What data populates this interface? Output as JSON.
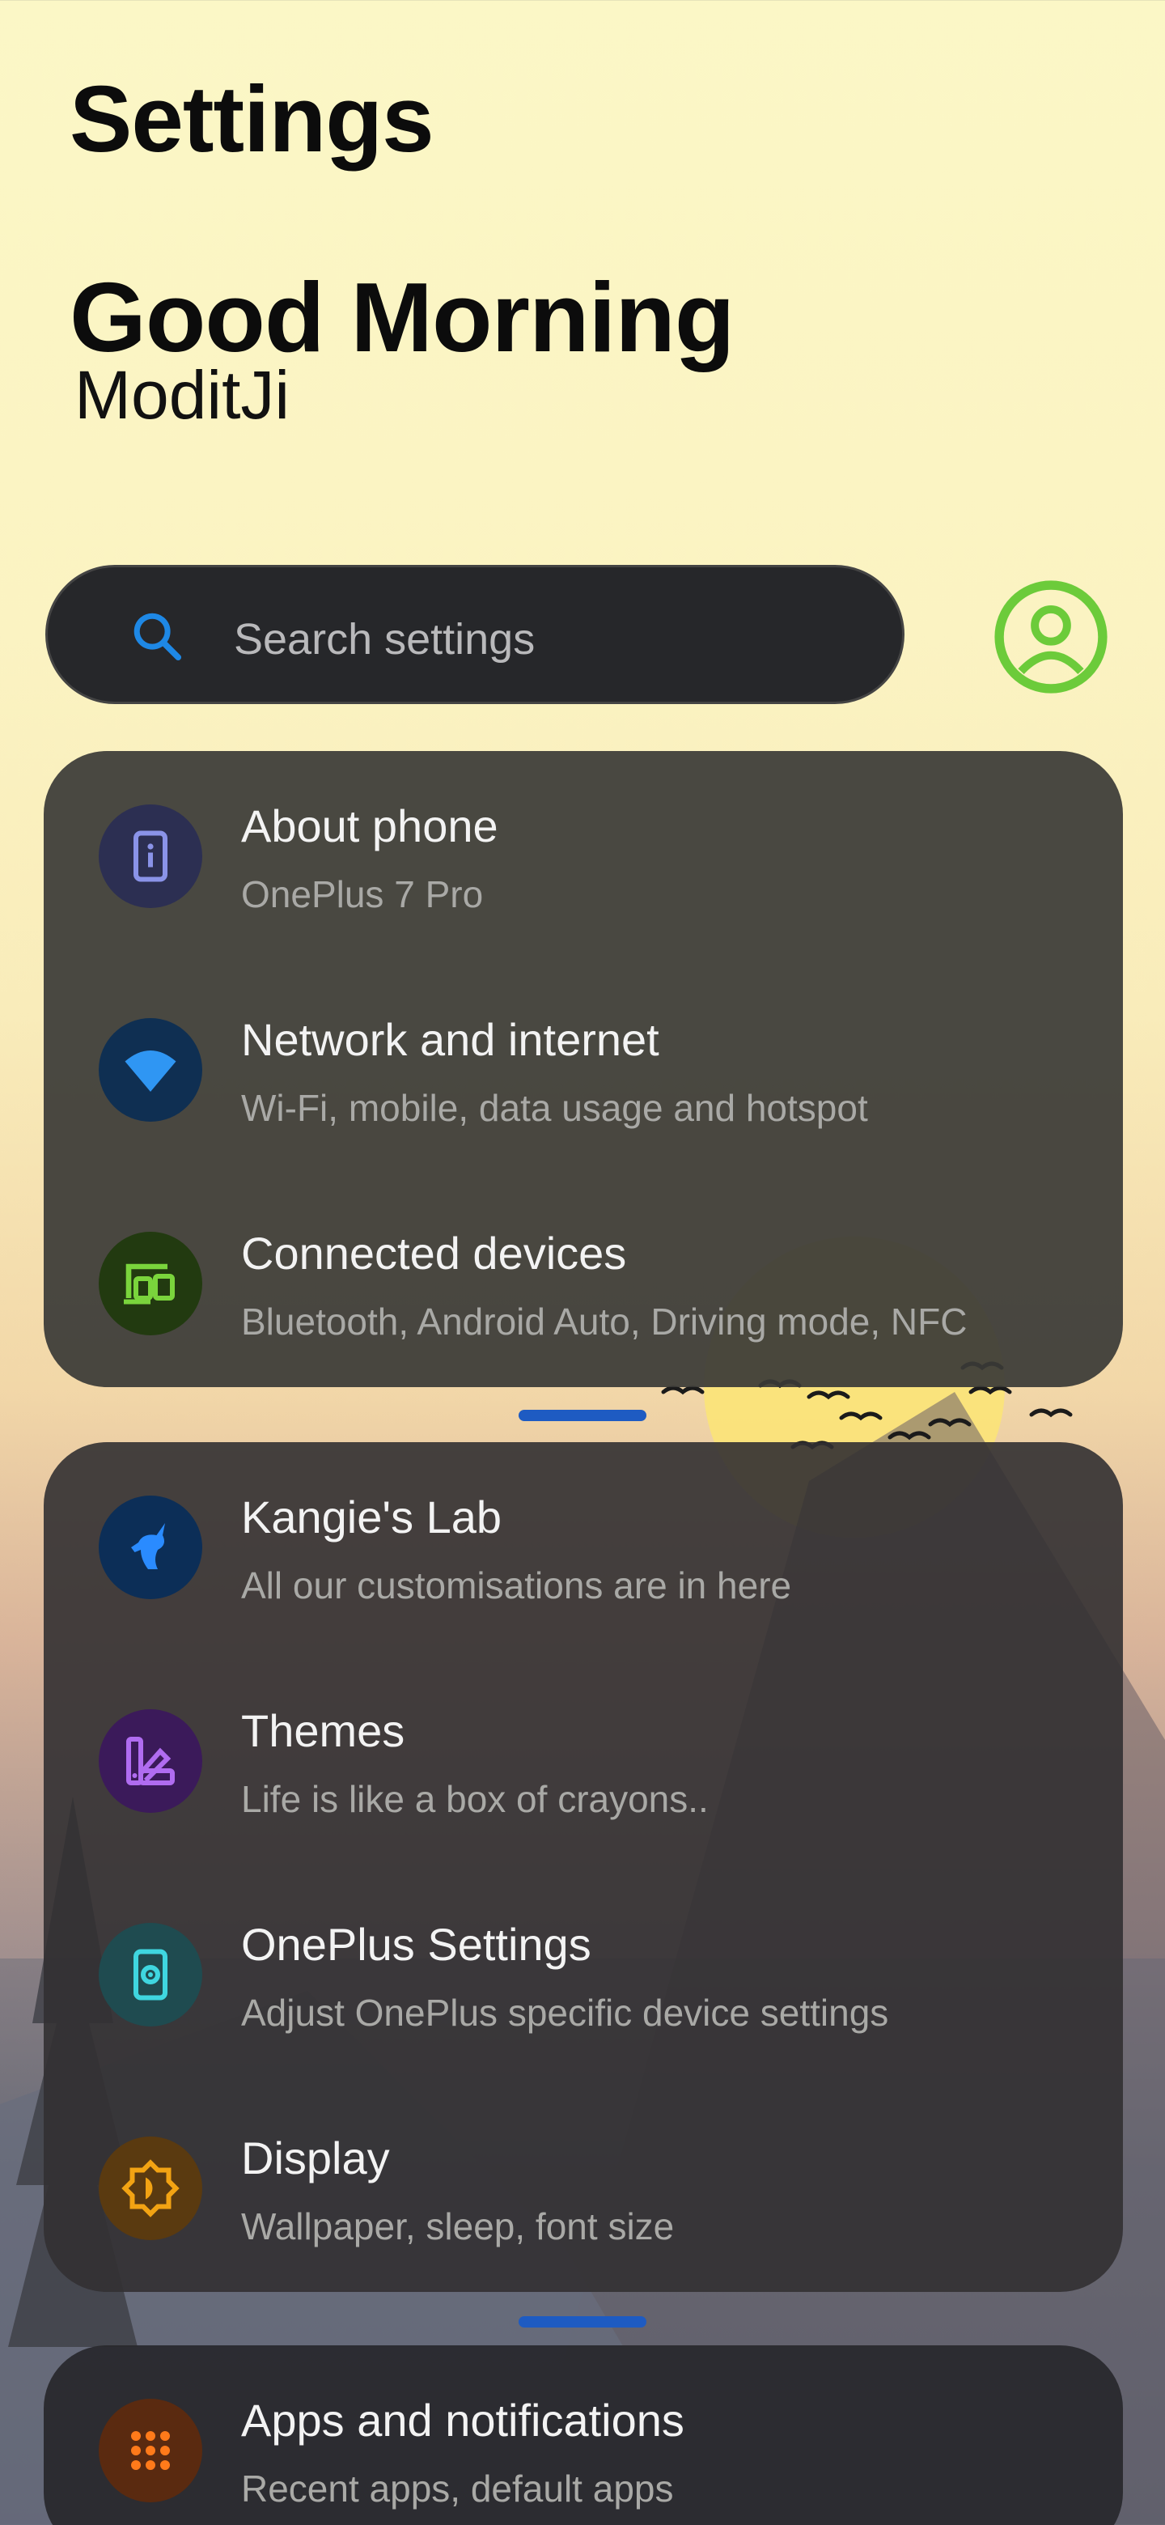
{
  "header": {
    "title": "Settings"
  },
  "greeting": {
    "text": "Good Morning",
    "name": "ModitJi"
  },
  "search": {
    "placeholder": "Search settings"
  },
  "colors": {
    "accent": "#1e88e5",
    "avatar": "#6ccb3a",
    "card_dark": "#3a3a36"
  },
  "groups": [
    {
      "items": [
        {
          "title": "About phone",
          "subtitle": "OnePlus 7 Pro",
          "icon": "phone-info-icon",
          "icon_color": "#8a93e8",
          "icon_bg": "#2c2f52"
        },
        {
          "title": "Network and internet",
          "subtitle": "Wi-Fi, mobile, data usage and hotspot",
          "icon": "wifi-icon",
          "icon_color": "#2f96f3",
          "icon_bg": "#0f2f52"
        },
        {
          "title": "Connected devices",
          "subtitle": "Bluetooth, Android Auto, Driving mode, NFC",
          "icon": "devices-icon",
          "icon_color": "#7ad43c",
          "icon_bg": "#223a10"
        }
      ]
    },
    {
      "items": [
        {
          "title": "Kangie's Lab",
          "subtitle": "All our customisations are in here",
          "icon": "unicorn-icon",
          "icon_color": "#2a8bff",
          "icon_bg": "#0c2e57"
        },
        {
          "title": "Themes",
          "subtitle": "Life is like a box of crayons..",
          "icon": "palette-icon",
          "icon_color": "#b06cf0",
          "icon_bg": "#3b1a5a"
        },
        {
          "title": "OnePlus Settings",
          "subtitle": "Adjust OnePlus specific device settings",
          "icon": "oneplus-settings-icon",
          "icon_color": "#3fd6e0",
          "icon_bg": "#1f4b50"
        },
        {
          "title": "Display",
          "subtitle": "Wallpaper, sleep, font size",
          "icon": "brightness-icon",
          "icon_color": "#f2a313",
          "icon_bg": "#5a3a10"
        }
      ]
    },
    {
      "items": [
        {
          "title": "Apps and notifications",
          "subtitle": "Recent apps, default apps",
          "icon": "apps-grid-icon",
          "icon_color": "#ff7a1a",
          "icon_bg": "#5a2a10"
        }
      ]
    }
  ]
}
